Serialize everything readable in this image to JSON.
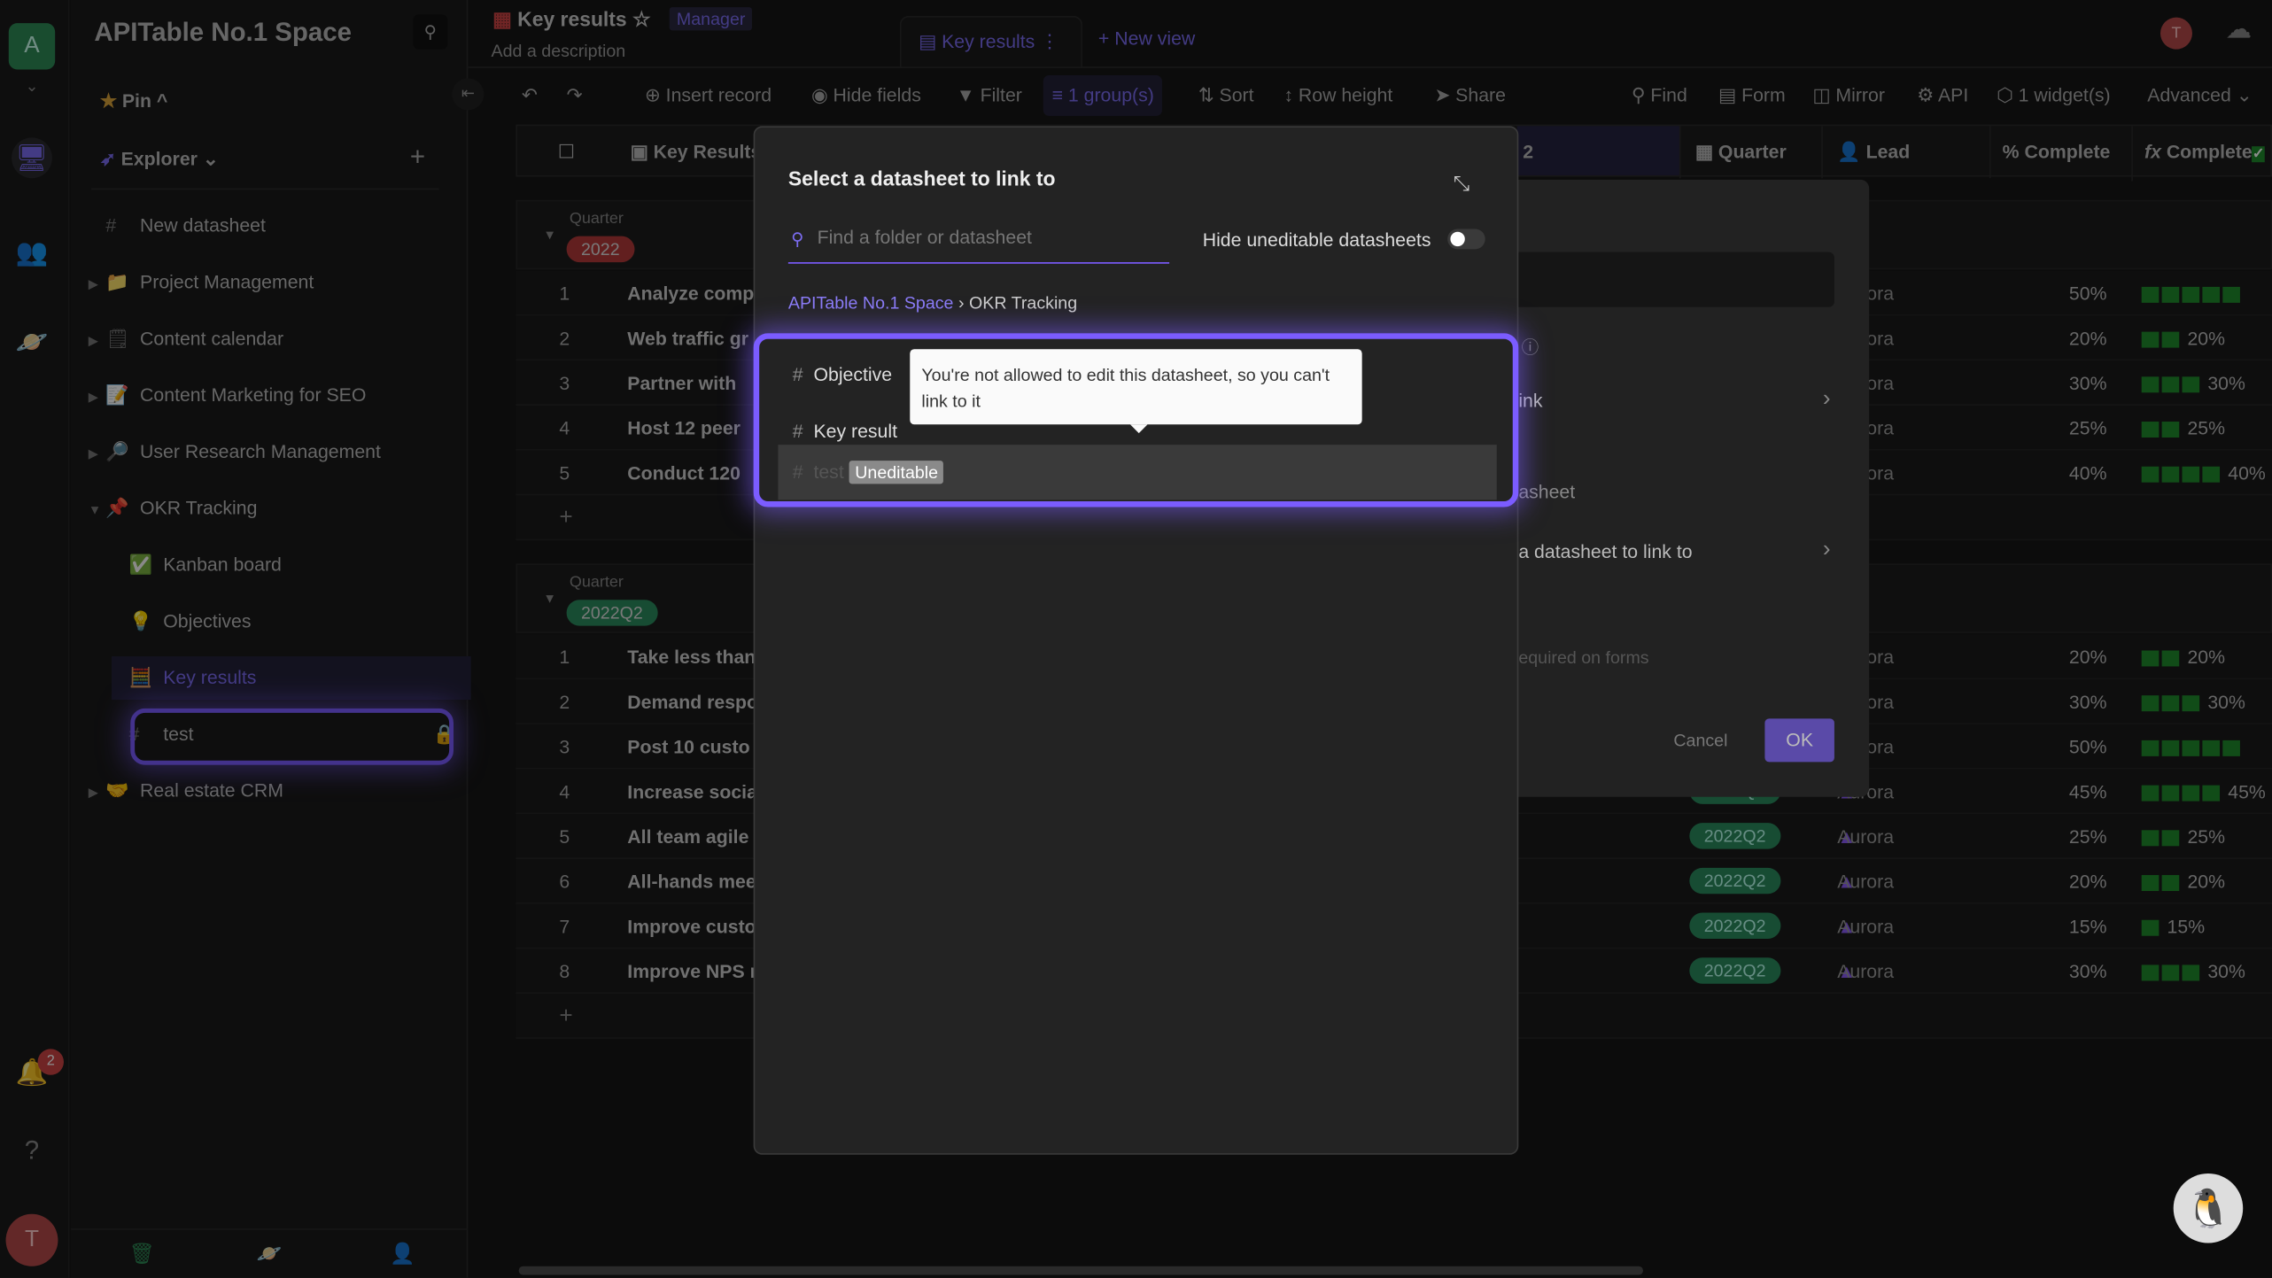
{
  "space": {
    "avatar": "A",
    "name": "APITable No.1 Space",
    "notif_count": "2",
    "user_initial": "T"
  },
  "sidebar": {
    "pin": "Pin",
    "explorer": "Explorer",
    "items": [
      {
        "label": "New datasheet",
        "icon": "#",
        "depth": 0,
        "arrow": ""
      },
      {
        "label": "Project Management",
        "icon": "📁",
        "depth": 0,
        "arrow": "▶"
      },
      {
        "label": "Content calendar",
        "icon": "🗒",
        "depth": 0,
        "arrow": "▶"
      },
      {
        "label": "Content Marketing for SEO",
        "icon": "📝",
        "depth": 0,
        "arrow": "▶"
      },
      {
        "label": "User Research Management",
        "icon": "🔎",
        "depth": 0,
        "arrow": "▶"
      },
      {
        "label": "OKR Tracking",
        "icon": "📌",
        "depth": 0,
        "arrow": "▼"
      },
      {
        "label": "Kanban board",
        "icon": "✅",
        "depth": 1,
        "arrow": ""
      },
      {
        "label": "Objectives",
        "icon": "💡",
        "depth": 1,
        "arrow": ""
      },
      {
        "label": "Key results",
        "icon": "🧮",
        "depth": 1,
        "arrow": "",
        "active": true
      },
      {
        "label": "test",
        "icon": "#",
        "depth": 1,
        "arrow": "",
        "locked": true
      },
      {
        "label": "Real estate CRM",
        "icon": "🤝",
        "depth": 0,
        "arrow": "▶"
      }
    ]
  },
  "header": {
    "title": "Key results",
    "role": "Manager",
    "description": "Add a description",
    "view_tab": "Key results",
    "new_view": "New view"
  },
  "toolbar": {
    "insert": "Insert record",
    "hide": "Hide fields",
    "filter": "Filter",
    "group": "1 group(s)",
    "sort": "Sort",
    "row_height": "Row height",
    "share": "Share",
    "find": "Find",
    "form": "Form",
    "mirror": "Mirror",
    "api": "API",
    "widgets": "1 widget(s)",
    "advanced": "Advanced"
  },
  "columns": {
    "key": "Key Results",
    "c2": "2",
    "quarter": "Quarter",
    "lead": "Lead",
    "pct": "Complete",
    "fx": "Complete"
  },
  "groups": [
    {
      "label": "Quarter",
      "value": "2022",
      "color": "#b23a3a",
      "rows": [
        {
          "n": "1",
          "title": "Analyze comp",
          "lead": "Aurora",
          "pct": "50%",
          "bars": 5
        },
        {
          "n": "2",
          "title": "Web traffic gr",
          "lead": "Aurora",
          "pct": "20%",
          "bars": 2
        },
        {
          "n": "3",
          "title": "Partner with",
          "lead": "Aurora",
          "pct": "30%",
          "bars": 3
        },
        {
          "n": "4",
          "title": "Host 12 peer",
          "lead": "Aurora",
          "pct": "25%",
          "bars": 2
        },
        {
          "n": "5",
          "title": "Conduct 120",
          "lead": "Aurora",
          "pct": "40%",
          "bars": 4
        }
      ]
    },
    {
      "label": "Quarter",
      "value": "2022Q2",
      "color": "#2a8a5e",
      "rows": [
        {
          "n": "1",
          "title": "Take less than",
          "lead": "Aurora",
          "pct": "20%",
          "bars": 2
        },
        {
          "n": "2",
          "title": "Demand respo",
          "lead": "Aurora",
          "pct": "30%",
          "bars": 3
        },
        {
          "n": "3",
          "title": "Post 10 custo",
          "lead": "Aurora",
          "pct": "50%",
          "bars": 5
        },
        {
          "n": "4",
          "title": "Increase socia",
          "quarter": "2022Q2",
          "lead": "Aurora",
          "pct": "45%",
          "bars": 4
        },
        {
          "n": "5",
          "title": "All team agile",
          "quarter": "2022Q2",
          "lead": "Aurora",
          "pct": "25%",
          "bars": 2
        },
        {
          "n": "6",
          "title": "All-hands mee",
          "quarter": "2022Q2",
          "lead": "Aurora",
          "pct": "20%",
          "bars": 2
        },
        {
          "n": "7",
          "title": "Improve custo",
          "quarter": "2022Q2",
          "lead": "Aurora",
          "pct": "15%",
          "bars": 1
        },
        {
          "n": "8",
          "title": "Improve NPS r",
          "quarter": "2022Q2",
          "lead": "Aurora",
          "pct": "30%",
          "bars": 3
        }
      ]
    }
  ],
  "bg_dialog": {
    "t1": "ink",
    "t2": "asheet",
    "t3": "a datasheet to link to",
    "t4": "equired on forms",
    "cancel": "Cancel",
    "ok": "OK"
  },
  "modal": {
    "title": "Select a datasheet to link to",
    "search_placeholder": "Find a folder or datasheet",
    "hide_toggle": "Hide uneditable datasheets",
    "hide_toggle_on": false,
    "breadcrumb_root": "APITable No.1 Space",
    "breadcrumb_leaf": "OKR Tracking",
    "items": [
      {
        "label": "Objective"
      },
      {
        "label": "Key result"
      },
      {
        "label": "test",
        "badge": "Uneditable"
      }
    ],
    "tooltip": "You're not allowed to edit this datasheet, so you can't link to it"
  },
  "colors": {
    "accent": "#7b5cff",
    "success": "#1f8a2c"
  }
}
